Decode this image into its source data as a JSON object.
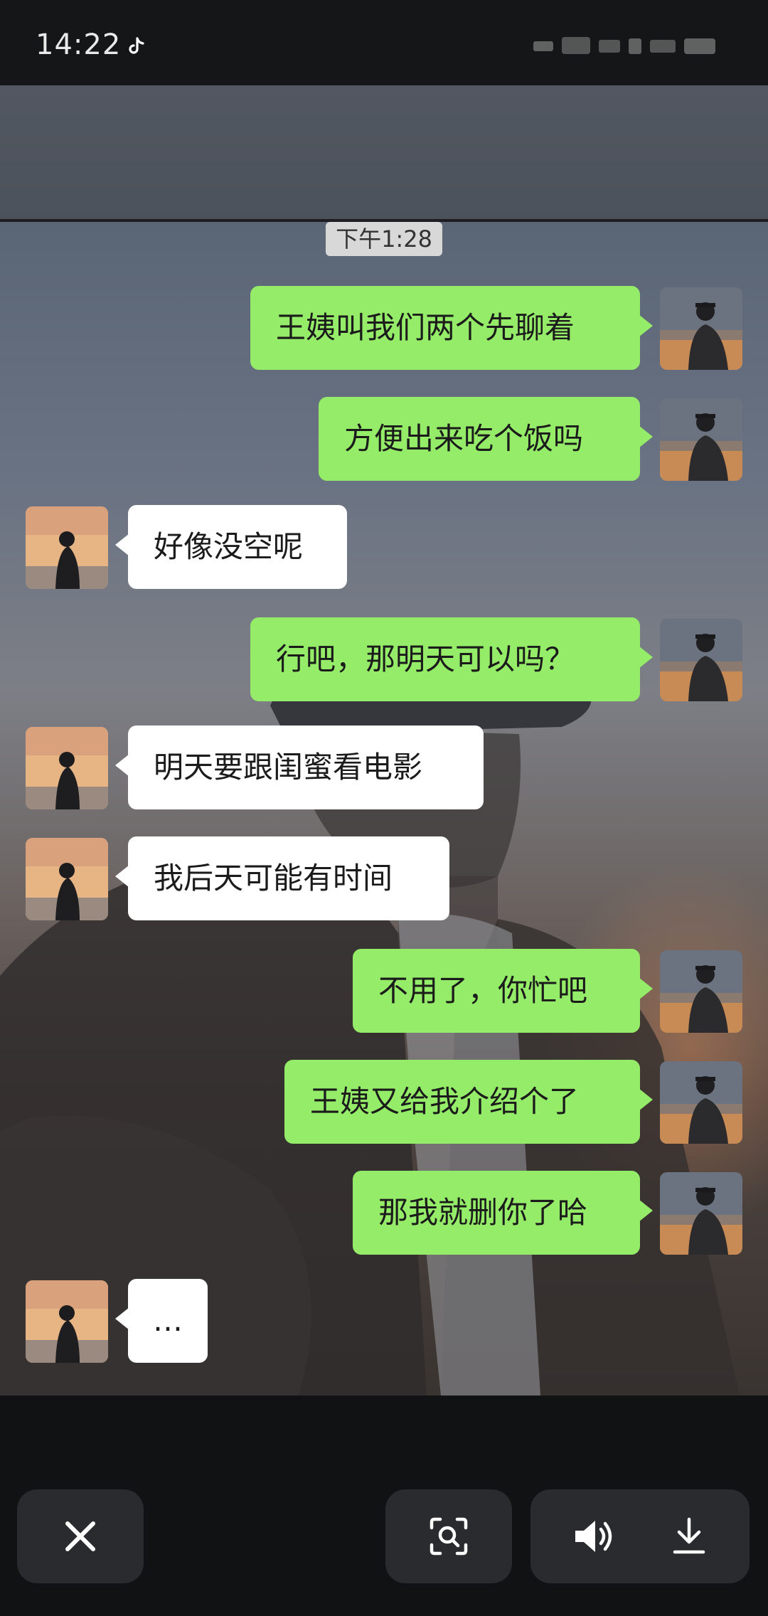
{
  "status_bar": {
    "time": "14:22",
    "app_icon": "tiktok-icon"
  },
  "chat": {
    "timestamp": "下午1:28",
    "messages": [
      {
        "sender": "me",
        "text": "王姨叫我们两个先聊着"
      },
      {
        "sender": "me",
        "text": "方便出来吃个饭吗"
      },
      {
        "sender": "them",
        "text": "好像没空呢"
      },
      {
        "sender": "me",
        "text": "行吧，那明天可以吗？"
      },
      {
        "sender": "them",
        "text": "明天要跟闺蜜看电影"
      },
      {
        "sender": "them",
        "text": "我后天可能有时间"
      },
      {
        "sender": "me",
        "text": "不用了，你忙吧"
      },
      {
        "sender": "me",
        "text": "王姨又给我介绍个了"
      },
      {
        "sender": "me",
        "text": "那我就删你了哈"
      },
      {
        "sender": "them",
        "text": "…"
      }
    ]
  },
  "bottom_bar": {
    "close_icon": "close-icon",
    "scan_icon": "image-search-icon",
    "volume_icon": "volume-icon",
    "download_icon": "download-icon"
  },
  "colors": {
    "my_bubble": "#95ec69",
    "their_bubble": "#ffffff",
    "bar_background": "#111214",
    "button_background": "#2a2b2e"
  }
}
